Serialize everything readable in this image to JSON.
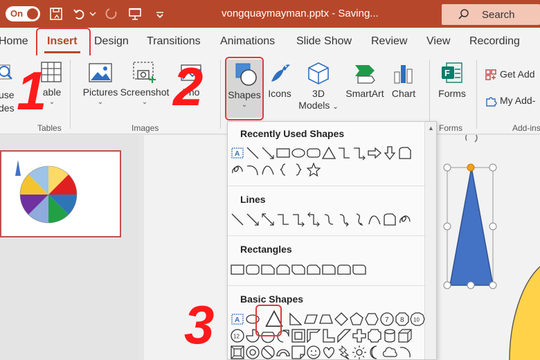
{
  "titlebar": {
    "autosave_label": "On",
    "document_title": "vongquaymayman.pptx - Saving...",
    "search_placeholder": "Search"
  },
  "tabs": [
    {
      "label": "Home",
      "active": false
    },
    {
      "label": "Insert",
      "active": true
    },
    {
      "label": "Design",
      "active": false
    },
    {
      "label": "Transitions",
      "active": false
    },
    {
      "label": "Animations",
      "active": false
    },
    {
      "label": "Slide Show",
      "active": false
    },
    {
      "label": "Review",
      "active": false
    },
    {
      "label": "View",
      "active": false
    },
    {
      "label": "Recording",
      "active": false
    }
  ],
  "ribbon": {
    "slides_partial": [
      "use",
      "des"
    ],
    "table_label": "able",
    "tables_group": "Tables",
    "pictures_label": "Pictures",
    "screenshot_label": "Screenshot",
    "photo_album_partial": "Pho",
    "images_group": "Images",
    "shapes_label": "Shapes",
    "icons_label": "Icons",
    "models_3d_line1": "3D",
    "models_3d_line2": "Models",
    "smartart_label": "SmartArt",
    "chart_label": "Chart",
    "forms_label": "Forms",
    "forms_group": "Forms",
    "get_addins_label": "Get Add",
    "my_addins_label": "My Add-",
    "addins_group": "Add-ins"
  },
  "annotations": {
    "step1": "1",
    "step2": "2",
    "step3": "3"
  },
  "shapes_menu": {
    "recently_used": "Recently Used Shapes",
    "lines": "Lines",
    "rectangles": "Rectangles",
    "basic_shapes": "Basic Shapes",
    "text_box_glyph": "A",
    "num_7": "7",
    "num_8": "8",
    "num_10": "10",
    "num_12": "12"
  },
  "colors": {
    "accent": "#b7472a",
    "slide_shape": "#4472c4",
    "annotation_red": "#ff1a1a"
  }
}
